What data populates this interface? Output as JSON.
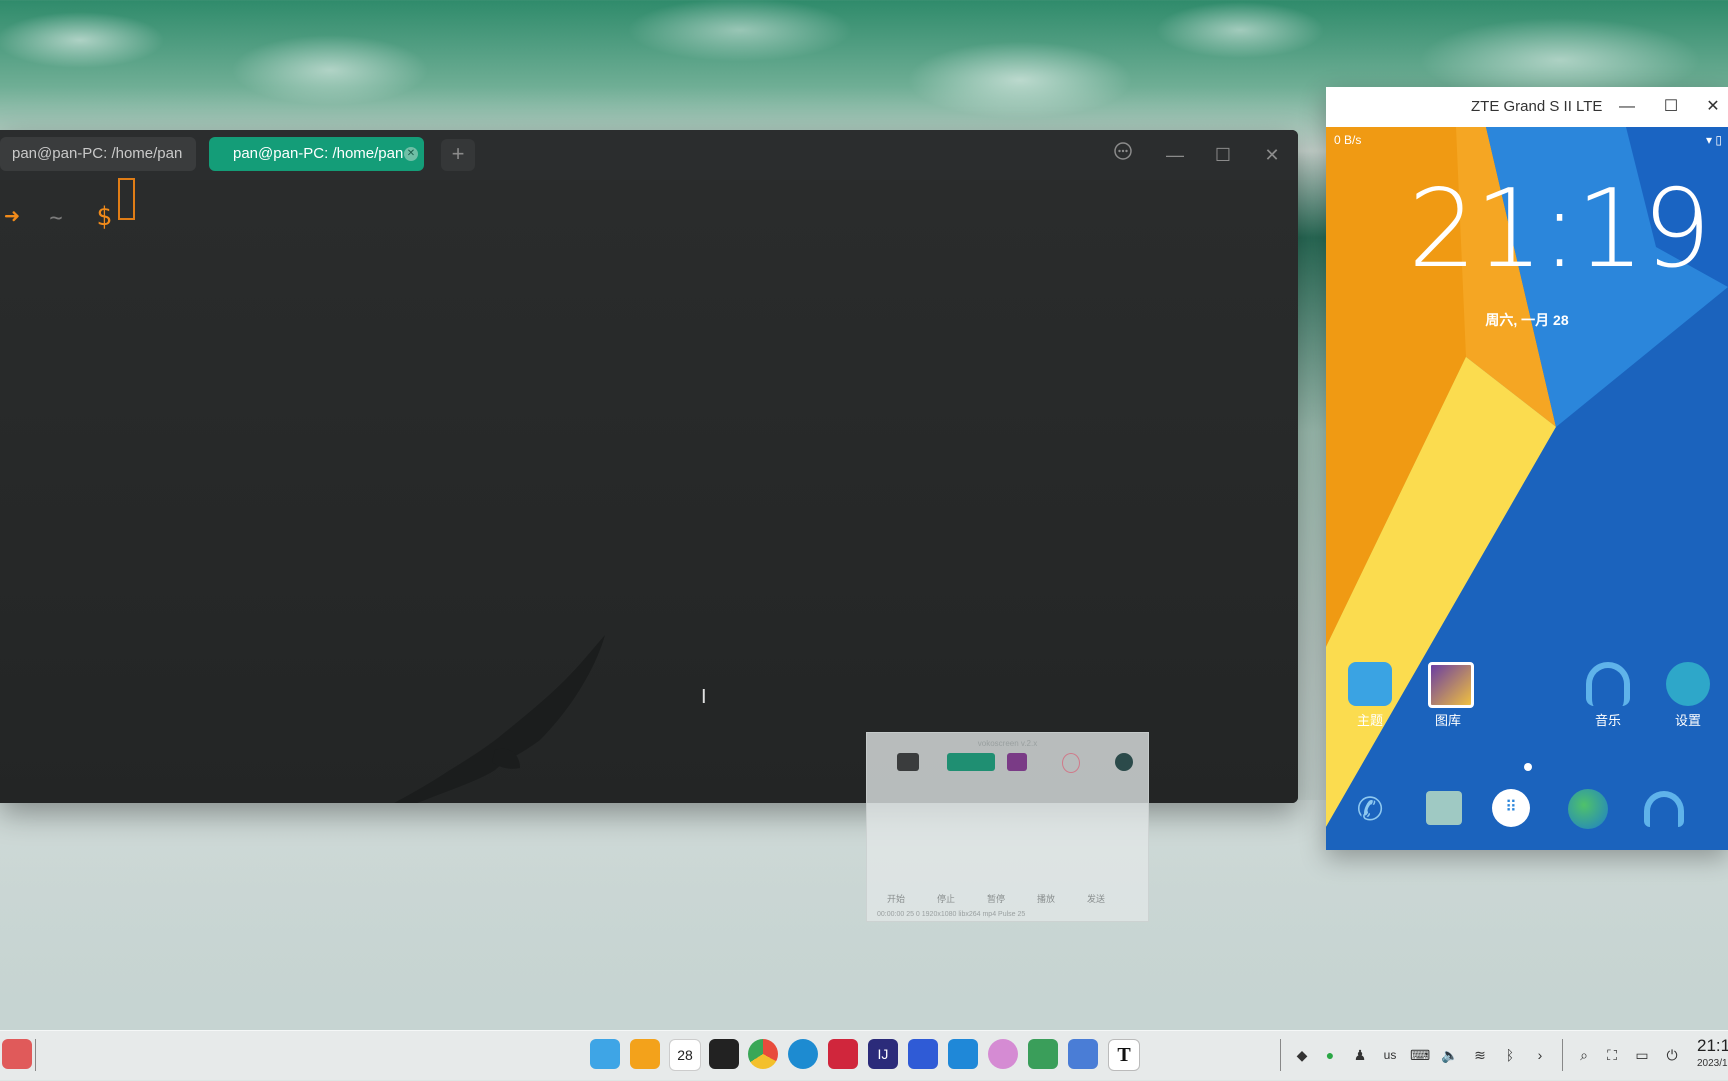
{
  "terminal": {
    "tabs": [
      {
        "label": "pan@pan-PC: /home/pan",
        "active": false
      },
      {
        "label": "pan@pan-PC: /home/pan",
        "active": true
      }
    ],
    "add_tab": "+",
    "prompt_arrow": "➜",
    "prompt_tilde": "~",
    "prompt_dollar": "$",
    "colors": {
      "accent": "#149d78",
      "prompt": "#f08a1a",
      "bg": "#252728"
    }
  },
  "android_window": {
    "title": "ZTE Grand S II LTE",
    "status_left": "0 B/s",
    "clock": "21:19",
    "date": "周六, 一月 28",
    "apps": [
      {
        "label": "主题",
        "icon": "theme-icon",
        "color": "#3aa3e3"
      },
      {
        "label": "图库",
        "icon": "gallery-icon",
        "color": "#6a3ea1"
      },
      {
        "label": "音乐",
        "icon": "music-icon",
        "color": "#3da3e0"
      },
      {
        "label": "设置",
        "icon": "settings-icon",
        "color": "#2ea7c9"
      }
    ],
    "dock": [
      {
        "icon": "phone-icon"
      },
      {
        "icon": "messages-icon"
      },
      {
        "icon": "app-drawer-icon"
      },
      {
        "icon": "browser-icon"
      },
      {
        "icon": "headphones-icon"
      }
    ]
  },
  "recorder": {
    "title": "vokoscreen v.2.x",
    "buttons": [
      "开始",
      "停止",
      "暂停",
      "播放",
      "发送"
    ],
    "status": "00:00:00   25   0   1920x1080   libx264   mp4   Pulse   25"
  },
  "taskbar": {
    "apps": [
      {
        "name": "deepin-file-manager",
        "color": "#3ea5e6"
      },
      {
        "name": "app-store",
        "color": "#f3a21b"
      },
      {
        "name": "calendar",
        "label": "28",
        "color": "#ffffff"
      },
      {
        "name": "qq",
        "color": "#222222"
      },
      {
        "name": "chrome",
        "color": "#e84b3c"
      },
      {
        "name": "edge",
        "color": "#1d8bd1"
      },
      {
        "name": "terminal",
        "color": "#d0263c"
      },
      {
        "name": "intellij-idea",
        "label": "IJ",
        "color": "#2b2b7a"
      },
      {
        "name": "wps",
        "color": "#2f5bd6"
      },
      {
        "name": "vscode",
        "color": "#1f88d8"
      },
      {
        "name": "system-settings",
        "color": "#d58bd3"
      },
      {
        "name": "android-studio",
        "color": "#3a9e5a"
      },
      {
        "name": "network-app",
        "color": "#4a7dd6"
      },
      {
        "name": "text-editor",
        "label": "T",
        "color": "#ffffff"
      }
    ],
    "input_method": "us",
    "time": "21:1",
    "date": "2023/1"
  }
}
